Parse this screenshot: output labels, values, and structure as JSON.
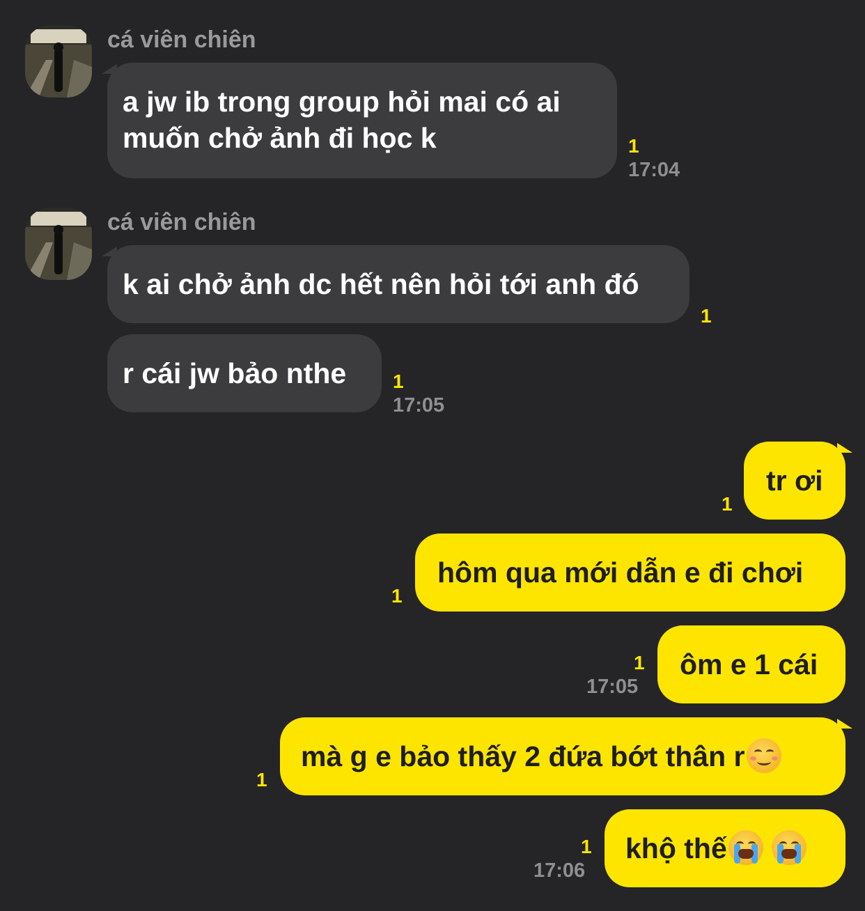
{
  "contact": {
    "name": "cá viên chiên",
    "avatar_icon": "avatar-photo-icon"
  },
  "colors": {
    "background": "#252528",
    "incoming_bubble": "#3c3c3f",
    "outgoing_bubble": "#fee500",
    "read_count": "#fee500",
    "timestamp": "#8f8f8f"
  },
  "messages": [
    {
      "direction": "incoming",
      "sender": "cá viên chiên",
      "lines": [
        "a jw ib trong group hỏi mai có ai",
        "muốn chở ảnh đi học k"
      ],
      "unread": "1",
      "time": "17:04"
    },
    {
      "direction": "incoming",
      "sender": "cá viên chiên",
      "text": "k ai chở ảnh dc hết nên hỏi tới anh đó",
      "unread": "1"
    },
    {
      "direction": "incoming",
      "text": "r cái jw bảo nthe",
      "unread": "1",
      "time": "17:05"
    },
    {
      "direction": "outgoing",
      "text": "tr ơi",
      "unread": "1"
    },
    {
      "direction": "outgoing",
      "text": "hôm qua mới dẫn e đi chơi",
      "unread": "1"
    },
    {
      "direction": "outgoing",
      "text": "ôm e 1 cái",
      "unread": "1",
      "time": "17:05"
    },
    {
      "direction": "outgoing",
      "text": "mà g e bảo thấy 2 đứa bớt thân r",
      "emoji": "smiling-blush-emoji",
      "unread": "1"
    },
    {
      "direction": "outgoing",
      "text": "khộ thế",
      "emoji": "loudly-crying-emoji ×2",
      "unread": "1",
      "time": "17:06"
    }
  ]
}
